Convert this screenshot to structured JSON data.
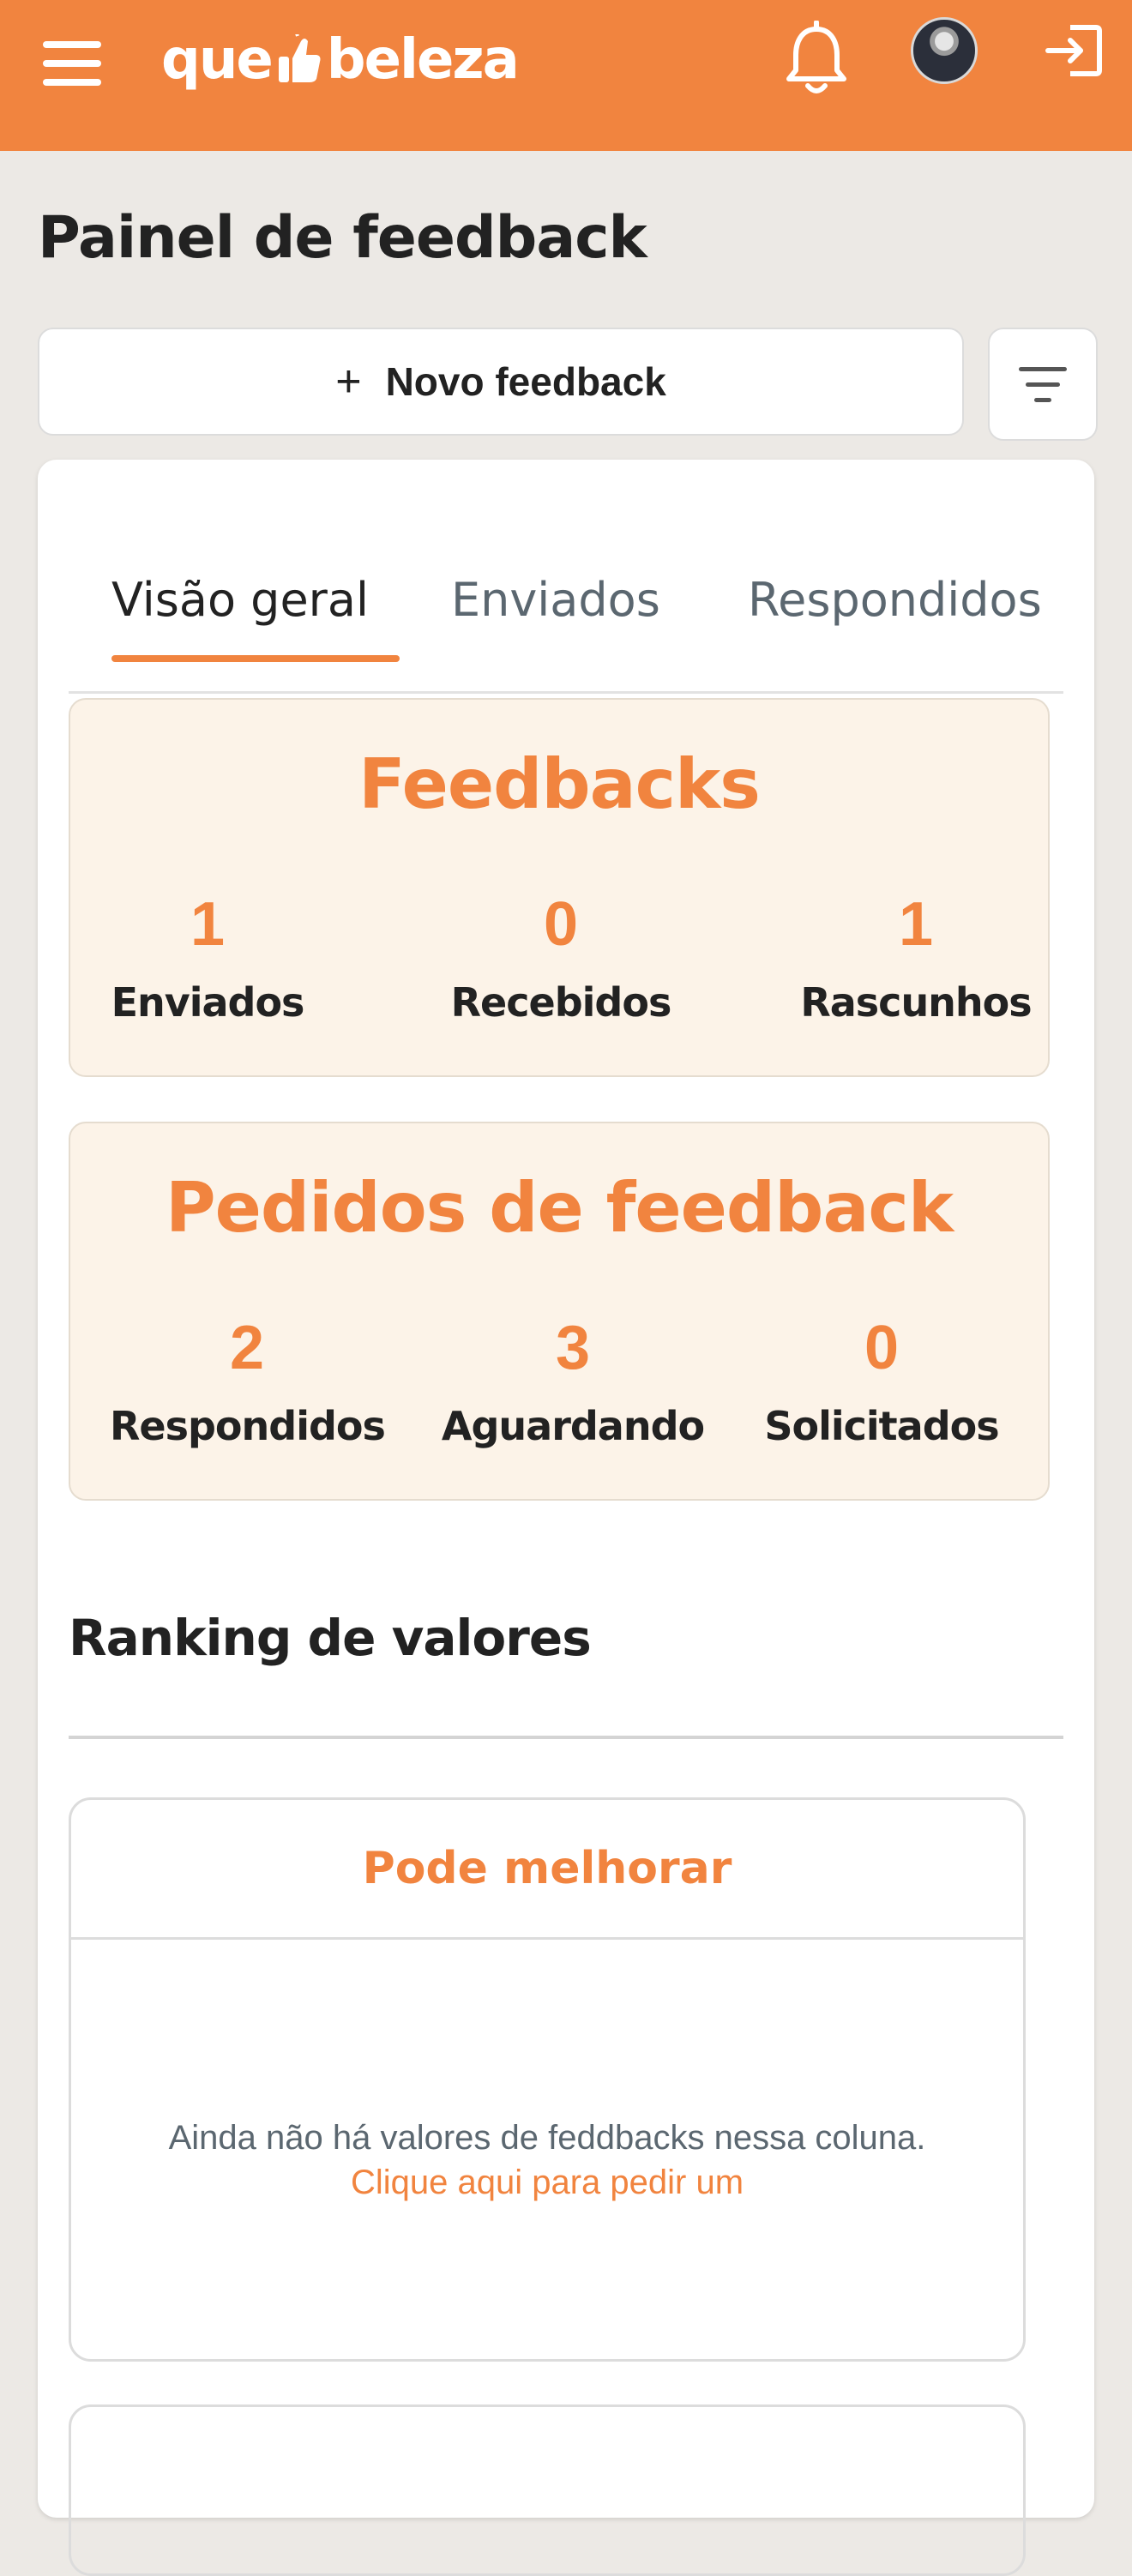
{
  "header": {
    "logo_left": "que",
    "logo_right": "beleza",
    "accent": "#f1843f",
    "icons": [
      "menu-icon",
      "thumbs-up-icon",
      "bell-icon",
      "avatar",
      "logout-icon"
    ]
  },
  "page": {
    "title": "Painel de feedback",
    "new_button_label": "Novo feedback",
    "new_button_icon": "+"
  },
  "tabs": [
    {
      "label": "Visão geral",
      "active": true
    },
    {
      "label": "Enviados",
      "active": false
    },
    {
      "label": "Respondidos",
      "active": false
    }
  ],
  "feedbacks": {
    "title": "Feedbacks",
    "stats": [
      {
        "value": "1",
        "label": "Enviados"
      },
      {
        "value": "0",
        "label": "Recebidos"
      },
      {
        "value": "1",
        "label": "Rascunhos"
      }
    ]
  },
  "requests": {
    "title": "Pedidos de feedback",
    "stats": [
      {
        "value": "2",
        "label": "Respondidos"
      },
      {
        "value": "3",
        "label": "Aguardando"
      },
      {
        "value": "0",
        "label": "Solicitados"
      }
    ]
  },
  "ranking": {
    "title": "Ranking de valores",
    "columns": [
      {
        "title": "Pode melhorar",
        "empty_text": "Ainda não há valores de feddbacks nessa coluna.",
        "empty_link": "Clique aqui para pedir um"
      }
    ]
  }
}
